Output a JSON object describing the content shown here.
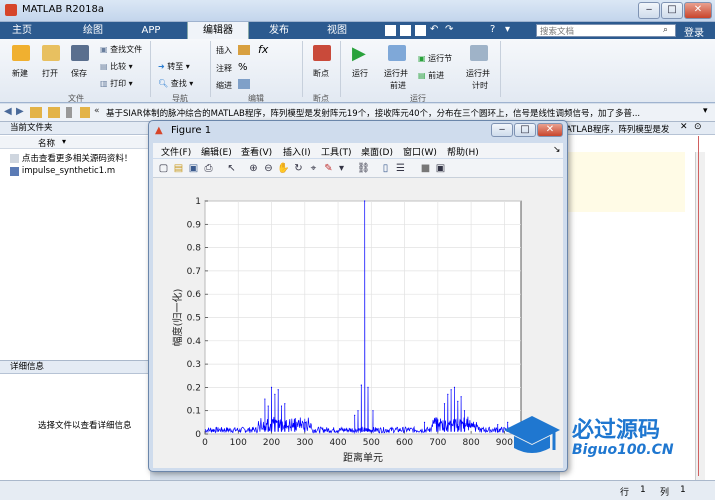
{
  "window": {
    "title": "MATLAB R2018a",
    "search_placeholder": "搜索文档",
    "login": "登录"
  },
  "tabs": [
    "主页",
    "绘图",
    "APP",
    "编辑器",
    "发布",
    "视图"
  ],
  "ribbon": {
    "file": {
      "new": "新建",
      "open": "打开",
      "save": "保存",
      "find_files": "查找文件",
      "compare": "比较",
      "print": "打印",
      "group": "文件"
    },
    "nav": {
      "goto": "转至",
      "find": "查找",
      "group": "导航"
    },
    "edit": {
      "insert": "插入",
      "comment": "注释",
      "indent": "缩进",
      "group": "编辑"
    },
    "breakpoints": {
      "label": "断点",
      "group": "断点"
    },
    "run": {
      "run": "运行",
      "run_advance_1": "运行并",
      "run_advance_2": "前进",
      "run_section": "运行节",
      "advance": "前进",
      "run_time_1": "运行并",
      "run_time_2": "计时",
      "group": "运行"
    }
  },
  "address": {
    "text": "基于SIAR体制的脉冲综合的MATLAB程序，阵列模型是发射阵元19个，接收阵元40个，分布在三个圆环上，信号是线性调频信号，加了多普..."
  },
  "left": {
    "header": "当前文件夹",
    "column": "名称",
    "files": [
      "点击查看更多相关源码资料！",
      "impulse_synthetic1.m"
    ],
    "details_header": "详细信息",
    "details_msg": "选择文件以查看详细信息"
  },
  "right": {
    "snippet": "ATLAB程序，阵列模型是发"
  },
  "status": {
    "row_label": "行",
    "row": "1",
    "col_label": "列",
    "col": "1"
  },
  "figure": {
    "title": "Figure 1",
    "menu": [
      "文件(F)",
      "编辑(E)",
      "查看(V)",
      "插入(I)",
      "工具(T)",
      "桌面(D)",
      "窗口(W)",
      "帮助(H)"
    ]
  },
  "chart_data": {
    "type": "line",
    "xlabel": "距离单元",
    "ylabel": "幅度(归一化)",
    "xlim": [
      0,
      950
    ],
    "ylim": [
      0,
      1
    ],
    "xticks": [
      0,
      100,
      200,
      300,
      400,
      500,
      600,
      700,
      800,
      900
    ],
    "yticks": [
      0,
      0.1,
      0.2,
      0.3,
      0.4,
      0.5,
      0.6,
      0.7,
      0.8,
      0.9,
      1
    ],
    "grid": true,
    "color": "#0000ff",
    "peaks": [
      {
        "x": 180,
        "y": 0.15
      },
      {
        "x": 190,
        "y": 0.12
      },
      {
        "x": 200,
        "y": 0.2
      },
      {
        "x": 210,
        "y": 0.17
      },
      {
        "x": 220,
        "y": 0.19
      },
      {
        "x": 230,
        "y": 0.12
      },
      {
        "x": 240,
        "y": 0.13
      },
      {
        "x": 270,
        "y": 0.06
      },
      {
        "x": 300,
        "y": 0.05
      },
      {
        "x": 450,
        "y": 0.08
      },
      {
        "x": 460,
        "y": 0.1
      },
      {
        "x": 470,
        "y": 0.21
      },
      {
        "x": 480,
        "y": 1.0
      },
      {
        "x": 490,
        "y": 0.2
      },
      {
        "x": 505,
        "y": 0.1
      },
      {
        "x": 660,
        "y": 0.05
      },
      {
        "x": 700,
        "y": 0.06
      },
      {
        "x": 720,
        "y": 0.13
      },
      {
        "x": 730,
        "y": 0.17
      },
      {
        "x": 740,
        "y": 0.19
      },
      {
        "x": 750,
        "y": 0.2
      },
      {
        "x": 760,
        "y": 0.14
      },
      {
        "x": 770,
        "y": 0.16
      },
      {
        "x": 780,
        "y": 0.1
      },
      {
        "x": 880,
        "y": 0.04
      },
      {
        "x": 910,
        "y": 0.05
      },
      {
        "x": 940,
        "y": 0.04
      }
    ]
  },
  "watermark": {
    "title": "必过源码",
    "site": "Biguo100.CN"
  }
}
